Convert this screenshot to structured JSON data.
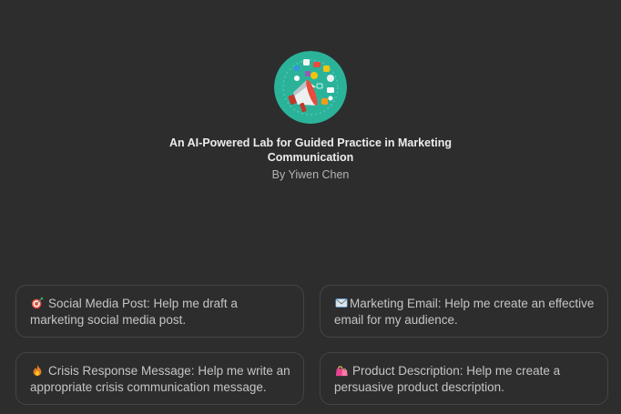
{
  "gpt": {
    "avatar_icon": "megaphone-marketing-icon",
    "title": "An AI-Powered Lab for Guided Practice in Marketing Communication",
    "author": "By Yiwen Chen"
  },
  "prompts": [
    {
      "icon": "target-dart-icon",
      "text": "Social Media Post: Help me draft a marketing social media post."
    },
    {
      "icon": "email-envelope-icon",
      "text": "Marketing Email: Help me create an effective email for my audience."
    },
    {
      "icon": "fire-icon",
      "text": "Crisis Response Message: Help me write an appropriate crisis communication message."
    },
    {
      "icon": "shopping-bags-icon",
      "text": "Product Description: Help me create a persuasive product description."
    }
  ],
  "colors": {
    "background": "#2d2d2d",
    "card_border": "#444444",
    "avatar_bg": "#2bb39a",
    "megaphone": "#e74c3c"
  }
}
